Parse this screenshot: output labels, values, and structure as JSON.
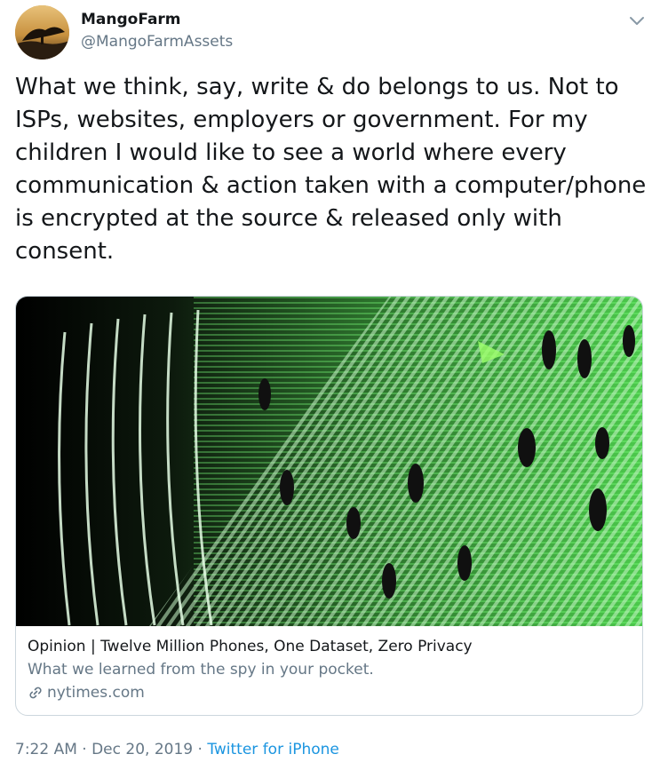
{
  "tweet": {
    "display_name": "MangoFarm",
    "handle": "@MangoFarmAssets",
    "text": "What we think, say, write & do belongs to us. Not to\nISPs, websites, employers or government. For my\nchildren I would like to see a world where every\ncommunication & action taken with a computer/phone\nis encrypted at the source & released only with\nconsent.",
    "timestamp": "7:22 AM · Dec 20, 2019",
    "separator": " · ",
    "source": "Twitter for iPhone"
  },
  "card": {
    "title": "Opinion | Twelve Million Phones, One Dataset, Zero Privacy",
    "description": "What we learned from the spy in your pocket.",
    "domain": "nytimes.com"
  },
  "icons": {
    "caret": "chevron-down-icon",
    "link": "link-icon"
  },
  "colors": {
    "text": "#14171a",
    "secondary": "#657786",
    "link": "#1b95e0",
    "border": "#ccd6dd",
    "image_green": "#3fd43f"
  }
}
